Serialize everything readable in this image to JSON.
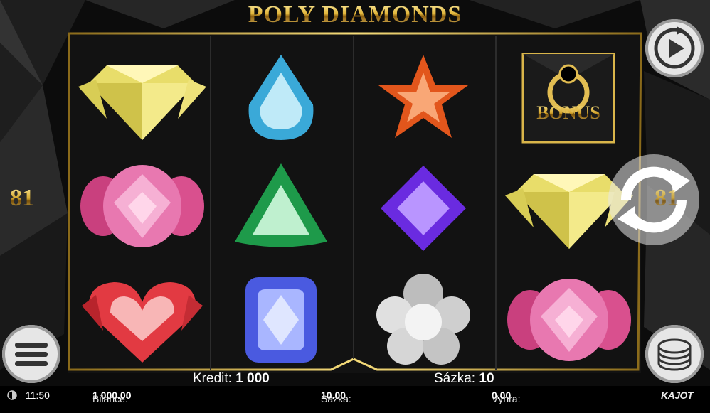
{
  "game": {
    "title": "POLY DIAMONDS",
    "lines_left": "81",
    "lines_right": "81"
  },
  "reels": [
    [
      "yellow-diamond",
      "pink-gem",
      "red-heart"
    ],
    [
      "blue-drop",
      "green-trillion",
      "blue-cushion"
    ],
    [
      "orange-star",
      "purple-square",
      "silver-flower"
    ],
    [
      "bonus-ring",
      "yellow-diamond",
      "pink-gem"
    ]
  ],
  "bonus": {
    "label": "BONUS"
  },
  "info": {
    "kredit_label": "Kredit:",
    "kredit_value": "1 000",
    "sazka_label": "Sázka:",
    "sazka_value": "10"
  },
  "status_bar": {
    "time": "11:50",
    "bilance_label": "Bilance:",
    "bilance_value": "1 000.00",
    "sazka_label": "Sázka:",
    "sazka_value": "10.00",
    "vyhra_label": "Výhra:",
    "vyhra_value": "0.00",
    "brand": "KAJOT"
  },
  "buttons": {
    "play": "play-icon",
    "autospin": "autospin-icon",
    "menu": "menu-icon",
    "bet": "chips-icon"
  }
}
